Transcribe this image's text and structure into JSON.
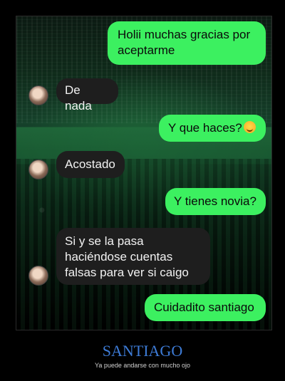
{
  "messages": [
    {
      "from": "me",
      "text": "Holii muchas gracias por aceptarme"
    },
    {
      "from": "other",
      "text": "De nada"
    },
    {
      "from": "me",
      "text": "Y que haces?",
      "emoji": "smirk-emoji"
    },
    {
      "from": "other",
      "text": "Acostado"
    },
    {
      "from": "me",
      "text": "Y tienes novia?"
    },
    {
      "from": "other",
      "text": "Si y se la pasa haciéndose cuentas falsas para ver si caigo"
    },
    {
      "from": "me",
      "text": "Cuidadito santiago"
    }
  ],
  "caption": {
    "title": "SANTIAGO",
    "subtitle": "Ya puede andarse con mucho ojo"
  },
  "colors": {
    "sent_bubble": "#3cf060",
    "received_bubble": "#1e1e1e",
    "caption_title": "#3d7bd6"
  }
}
